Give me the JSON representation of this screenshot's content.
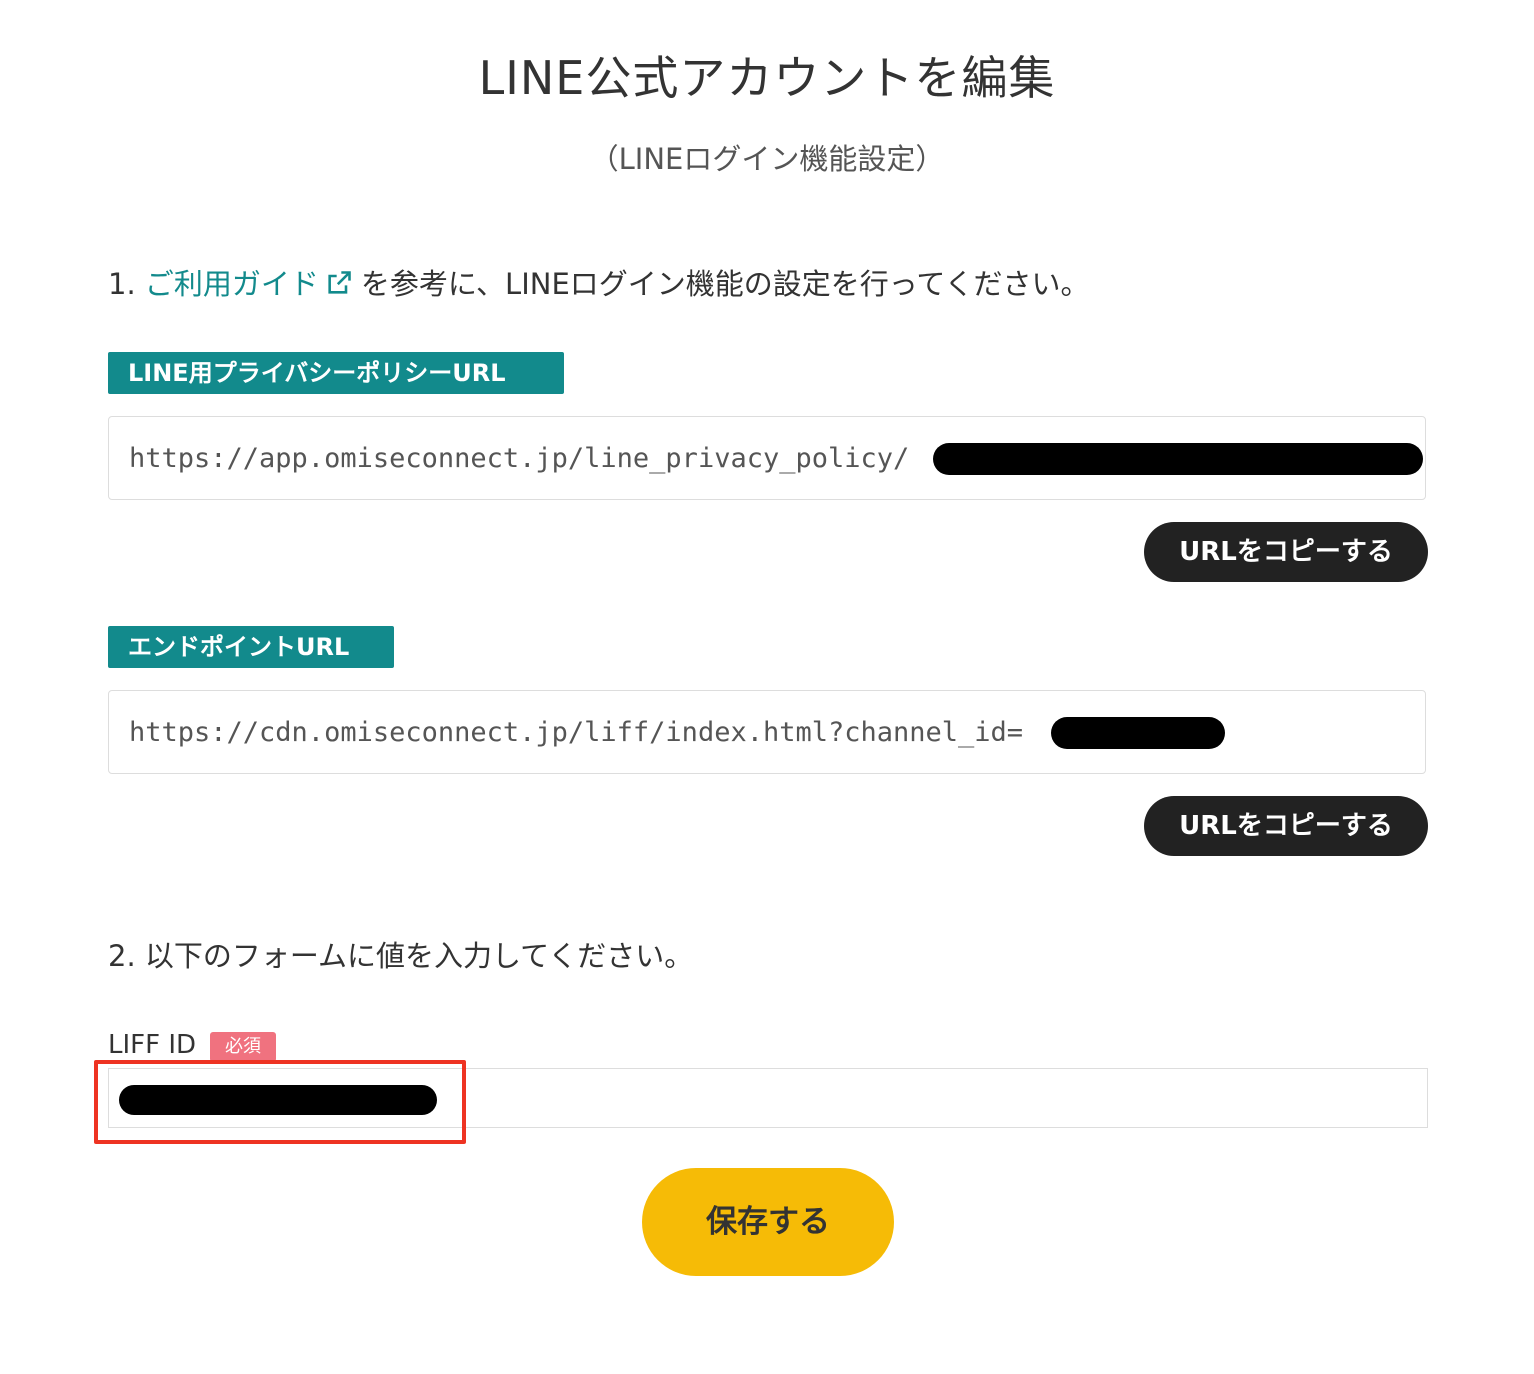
{
  "header": {
    "title": "LINE公式アカウントを編集",
    "subtitle": "（LINEログイン機能設定）"
  },
  "step1": {
    "prefix": "1. ",
    "link_text": "ご利用ガイド",
    "link_icon": "external-link-icon",
    "suffix": "を参考に、LINEログイン機能の設定を行ってください。"
  },
  "privacy": {
    "label": "LINE用プライバシーポリシーURL",
    "url": "https://app.omiseconnect.jp/line_privacy_policy/",
    "copy_label": "URLをコピーする"
  },
  "endpoint": {
    "label": "エンドポイントURL",
    "url": "https://cdn.omiseconnect.jp/liff/index.html?channel_id=",
    "copy_label": "URLをコピーする"
  },
  "step2": {
    "text": "2. 以下のフォームに値を入力してください。"
  },
  "liff": {
    "label": "LIFF ID",
    "required_badge": "必須"
  },
  "save_button": "保存する",
  "colors": {
    "teal": "#128a8c",
    "dark_button": "#222222",
    "save_yellow": "#f6bb06",
    "required_pink": "#f0727f",
    "highlight_red": "#ee3322"
  }
}
